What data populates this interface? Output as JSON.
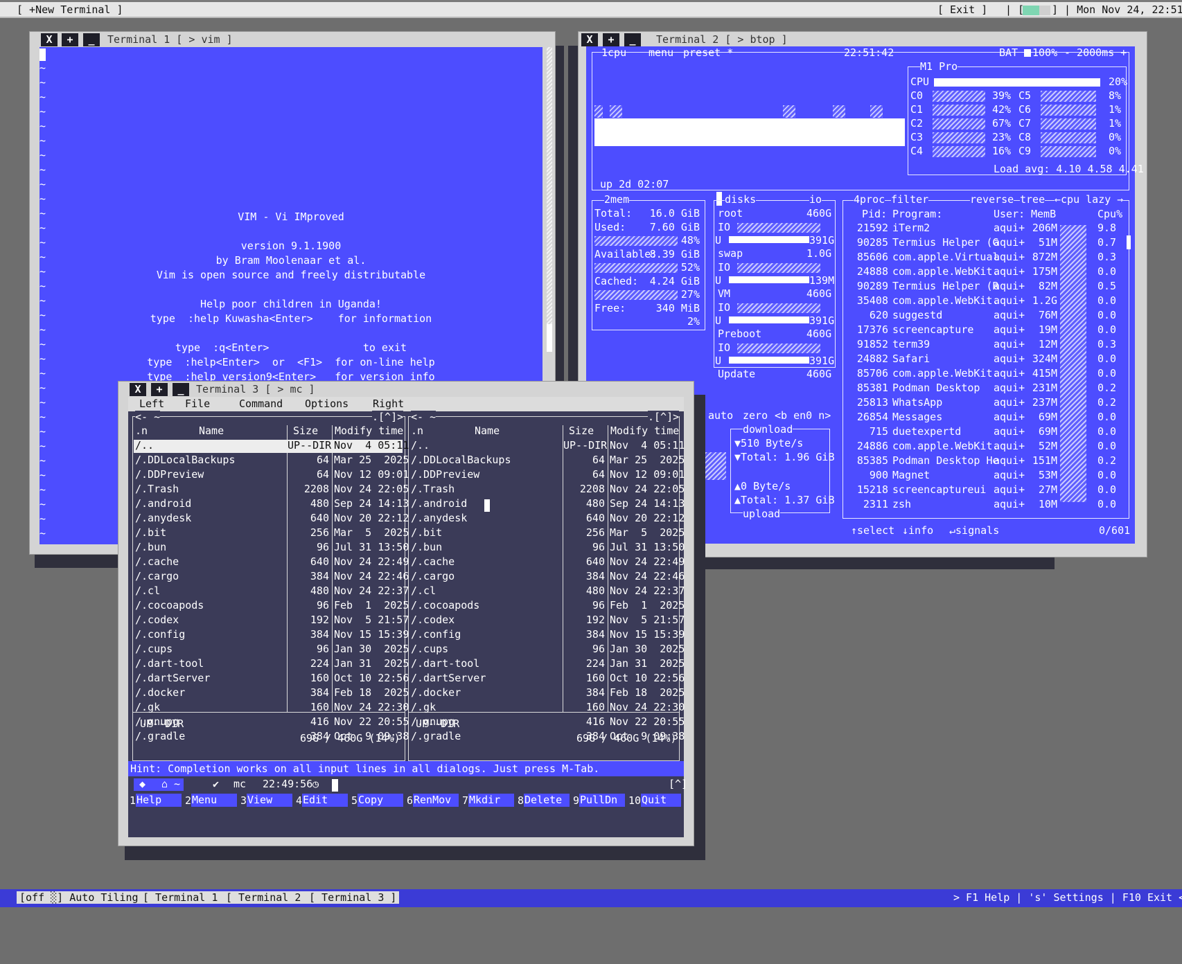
{
  "topbar": {
    "new_terminal": "[ +New Terminal ]",
    "exit": "[ Exit ]",
    "sep": "| [",
    "sep2": "] | Mon Nov 24, 22:51"
  },
  "bottombar": {
    "mode": "[off ░] Auto Tiling",
    "tabs": [
      "[ Terminal 1 ]",
      "[ Terminal 2 ]",
      "[ Terminal 3 ]"
    ],
    "help": "> F1 Help | 's' Settings | F10 Exit <"
  },
  "win_buttons": {
    "close": "X",
    "add": "+",
    "min": "_"
  },
  "t1": {
    "title": "Terminal 1 [ > vim ]",
    "lines": [
      "VIM - Vi IMproved",
      "",
      "version 9.1.1900",
      "by Bram Moolenaar et al.",
      "Vim is open source and freely distributable",
      "",
      "Help poor children in Uganda!",
      "type  :help Kuwasha<Enter>    for information",
      "",
      "type  :q<Enter>               to exit",
      "type  :help<Enter>  or  <F1>  for on-line help",
      "type  :help version9<Enter>   for version info"
    ]
  },
  "t2": {
    "title": "Terminal 2 [ > btop ]",
    "header": {
      "cpu": "1cpu",
      "menu": "menu",
      "preset": "preset *",
      "clock": "22:51:42",
      "bat": "BAT",
      "bat_pct": "100%",
      "interval": "- 2000ms +"
    },
    "cpu_box": {
      "title": "M1 Pro",
      "cpu_label": "CPU",
      "cpu_pct": "20%",
      "uptime": "up 2d 02:07",
      "load": "Load avg: 4.10 4.58 4.41",
      "cores": [
        {
          "n": "C0",
          "p": "39%",
          "f": 0.39
        },
        {
          "n": "C1",
          "p": "42%",
          "f": 0.42
        },
        {
          "n": "C2",
          "p": "67%",
          "f": 0.67
        },
        {
          "n": "C3",
          "p": "23%",
          "f": 0.23
        },
        {
          "n": "C4",
          "p": "16%",
          "f": 0.16
        }
      ],
      "cores2": [
        {
          "n": "C5",
          "p": "8%"
        },
        {
          "n": "C6",
          "p": "1%"
        },
        {
          "n": "C7",
          "p": "1%"
        },
        {
          "n": "C8",
          "p": "0%"
        },
        {
          "n": "C9",
          "p": "0%"
        }
      ]
    },
    "mem": {
      "title": "2mem",
      "total_l": "Total:",
      "total_v": "16.0 GiB",
      "used_l": "Used:",
      "used_v": "7.60 GiB",
      "used_p": "48%",
      "avail_l": "Available:",
      "avail_v": "8.39 GiB",
      "avail_p": "52%",
      "cached_l": "Cached:",
      "cached_v": "4.24 GiB",
      "cached_p": "27%",
      "free_l": "Free:",
      "free_v": "340 MiB",
      "free_p": "2%"
    },
    "disks": {
      "title": "disks",
      "io": "io",
      "rows": [
        {
          "name": "root",
          "size": "460G",
          "u": "391G"
        },
        {
          "name": "swap",
          "size": "1.0G",
          "u": "139M"
        },
        {
          "name": "VM",
          "size": "460G",
          "u": "391G"
        },
        {
          "name": "Preboot",
          "size": "460G",
          "u": "391G"
        },
        {
          "name": "Update",
          "size": "460G",
          "u": ""
        }
      ],
      "io_l": "IO",
      "u_l": "U"
    },
    "net": {
      "auto": "auto",
      "zero": "zero",
      "iface": "<b en0 n>",
      "download": "download",
      "dl_rate": "▼510 Byte/s",
      "dl_total": "▼Total: 1.96 GiB",
      "ul_rate": "▲0 Byte/s",
      "ul_total": "▲Total: 1.37 GiB",
      "upload": "upload"
    },
    "proc": {
      "title": "4proc",
      "filter": "filter",
      "reverse": "reverse",
      "tree": "tree",
      "cpu_lazy": "←cpu lazy →",
      "h_pid": "Pid:",
      "h_prog": "Program:",
      "h_user": "User:",
      "h_mem": "MemB",
      "h_cpu": "Cpu%",
      "rows": [
        [
          "21592",
          "iTerm2",
          "aqui+",
          "206M",
          "9.8"
        ],
        [
          "90285",
          "Termius Helper (G",
          "aqui+",
          "51M",
          "0.7"
        ],
        [
          "85606",
          "com.apple.Virtual",
          "aqui+",
          "872M",
          "0.3"
        ],
        [
          "24888",
          "com.apple.WebKit.",
          "aqui+",
          "175M",
          "0.0"
        ],
        [
          "90289",
          "Termius Helper (R",
          "aqui+",
          "82M",
          "0.5"
        ],
        [
          "35408",
          "com.apple.WebKit.",
          "aqui+",
          "1.2G",
          "0.0"
        ],
        [
          "620",
          "suggestd",
          "aqui+",
          "76M",
          "0.0"
        ],
        [
          "17376",
          "screencapture",
          "aqui+",
          "19M",
          "0.0"
        ],
        [
          "91852",
          "term39",
          "aqui+",
          "12M",
          "0.3"
        ],
        [
          "24882",
          "Safari",
          "aqui+",
          "324M",
          "0.0"
        ],
        [
          "85706",
          "com.apple.WebKit.",
          "aqui+",
          "415M",
          "0.0"
        ],
        [
          "85381",
          "Podman Desktop",
          "aqui+",
          "231M",
          "0.2"
        ],
        [
          "25813",
          "WhatsApp",
          "aqui+",
          "237M",
          "0.2"
        ],
        [
          "26854",
          "Messages",
          "aqui+",
          "69M",
          "0.0"
        ],
        [
          "715",
          "duetexpertd",
          "aqui+",
          "69M",
          "0.0"
        ],
        [
          "24886",
          "com.apple.WebKit.",
          "aqui+",
          "52M",
          "0.0"
        ],
        [
          "85385",
          "Podman Desktop He",
          "aqui+",
          "151M",
          "0.2"
        ],
        [
          "900",
          "Magnet",
          "aqui+",
          "53M",
          "0.0"
        ],
        [
          "15218",
          "screencaptureui",
          "aqui+",
          "27M",
          "0.0"
        ],
        [
          "2311",
          "zsh",
          "aqui+",
          "10M",
          "0.0"
        ]
      ],
      "select": "↑select",
      "info": "↓info",
      "signals": "↵signals",
      "count": "0/601"
    }
  },
  "t3": {
    "title": "Terminal 3 [ > mc ]",
    "menu": [
      "Left",
      "File",
      "Command",
      "Options",
      "Right"
    ],
    "panel_hdr": {
      "left": "<- ~",
      "right": ".[^]>",
      "n": ".n",
      "name": "Name",
      "size": "Size",
      "mtime": "Modify time"
    },
    "files": [
      [
        "/..",
        "UP--DIR",
        "Nov  4 05:11"
      ],
      [
        "/.DDLocalBackups",
        "64",
        "Mar 25  2025"
      ],
      [
        "/.DDPreview",
        "64",
        "Nov 12 09:01"
      ],
      [
        "/.Trash",
        "2208",
        "Nov 24 22:05"
      ],
      [
        "/.android",
        "480",
        "Sep 24 14:13"
      ],
      [
        "/.anydesk",
        "640",
        "Nov 20 22:12"
      ],
      [
        "/.bit",
        "256",
        "Mar  5  2025"
      ],
      [
        "/.bun",
        "96",
        "Jul 31 13:50"
      ],
      [
        "/.cache",
        "640",
        "Nov 24 22:49"
      ],
      [
        "/.cargo",
        "384",
        "Nov 24 22:46"
      ],
      [
        "/.cl",
        "480",
        "Nov 24 22:37"
      ],
      [
        "/.cocoapods",
        "96",
        "Feb  1  2025"
      ],
      [
        "/.codex",
        "192",
        "Nov  5 21:57"
      ],
      [
        "/.config",
        "384",
        "Nov 15 15:39"
      ],
      [
        "/.cups",
        "96",
        "Jan 30  2025"
      ],
      [
        "/.dart-tool",
        "224",
        "Jan 31  2025"
      ],
      [
        "/.dartServer",
        "160",
        "Oct 10 22:56"
      ],
      [
        "/.docker",
        "384",
        "Feb 18  2025"
      ],
      [
        "/.gk",
        "160",
        "Nov 24 22:30"
      ],
      [
        "/.gnupg",
        "416",
        "Nov 22 20:55"
      ],
      [
        "/.gradle",
        "384",
        "Oct  9 09:38"
      ]
    ],
    "status": "UP--DIR",
    "disk": "69G / 460G (14%)",
    "hint": "Hint: Completion works on all input lines in all dialogs. Just press M-Tab.",
    "prompt": {
      "mc": "mc",
      "time": "22:49:56",
      "bracket": "[^]"
    },
    "fkeys": [
      [
        "1",
        "Help"
      ],
      [
        "2",
        "Menu"
      ],
      [
        "3",
        "View"
      ],
      [
        "4",
        "Edit"
      ],
      [
        "5",
        "Copy"
      ],
      [
        "6",
        "RenMov"
      ],
      [
        "7",
        "Mkdir"
      ],
      [
        "8",
        "Delete"
      ],
      [
        "9",
        "PullDn"
      ],
      [
        "10",
        "Quit"
      ]
    ]
  }
}
